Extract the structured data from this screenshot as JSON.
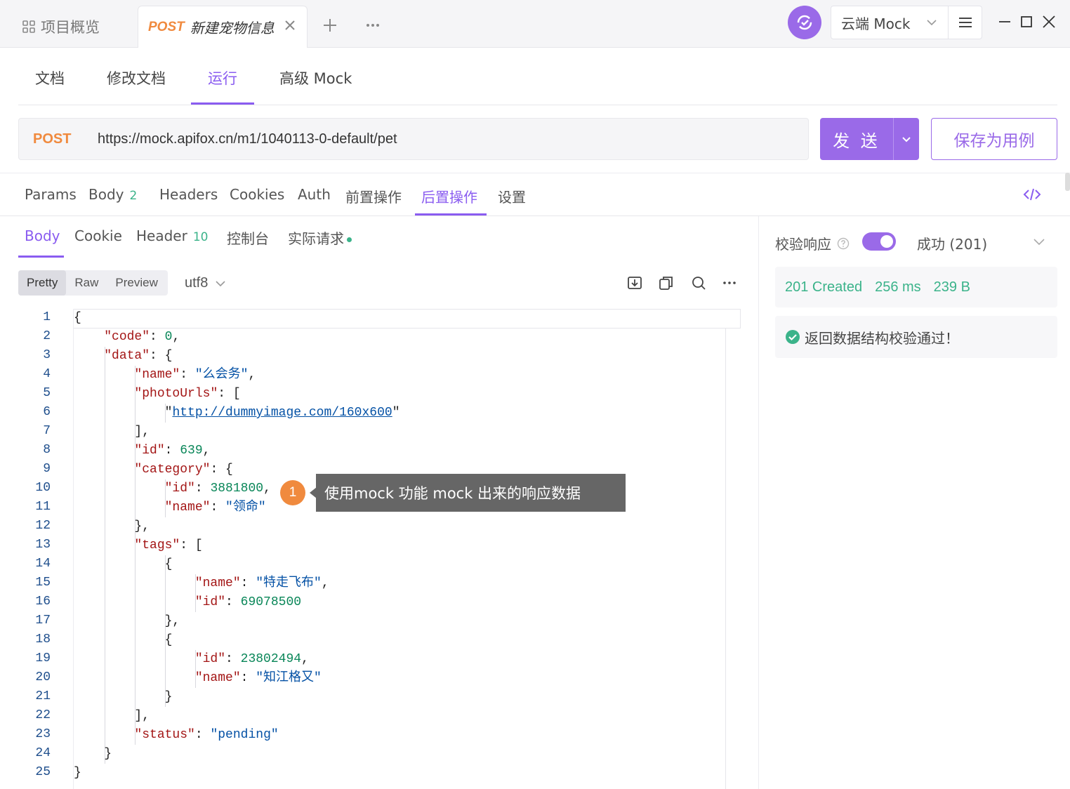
{
  "tabs": {
    "overview_label": "项目概览",
    "active_method": "POST",
    "active_title": "新建宠物信息"
  },
  "env": {
    "label": "云端 Mock"
  },
  "doc_tabs": [
    "文档",
    "修改文档",
    "运行",
    "高级 Mock"
  ],
  "request": {
    "method": "POST",
    "url": "https://mock.apifox.cn/m1/1040113-0-default/pet",
    "send_label": "发 送",
    "save_label": "保存为用例"
  },
  "req_tabs": {
    "params": "Params",
    "body": "Body",
    "body_count": "2",
    "headers": "Headers",
    "cookies": "Cookies",
    "auth": "Auth",
    "pre": "前置操作",
    "post": "后置操作",
    "settings": "设置"
  },
  "resp_tabs": {
    "body": "Body",
    "cookie": "Cookie",
    "header": "Header",
    "header_count": "10",
    "console": "控制台",
    "actual": "实际请求"
  },
  "view_modes": [
    "Pretty",
    "Raw",
    "Preview"
  ],
  "encoding": "utf8",
  "response_lines": [
    "{",
    "    \"code\": 0,",
    "    \"data\": {",
    "        \"name\": \"么会务\",",
    "        \"photoUrls\": [",
    "            \"http://dummyimage.com/160x600\"",
    "        ],",
    "        \"id\": 639,",
    "        \"category\": {",
    "            \"id\": 3881800,",
    "            \"name\": \"领命\"",
    "        },",
    "        \"tags\": [",
    "            {",
    "                \"name\": \"特走飞布\",",
    "                \"id\": 69078500",
    "            },",
    "            {",
    "                \"id\": 23802494,",
    "                \"name\": \"知江格又\"",
    "            }",
    "        ],",
    "        \"status\": \"pending\"",
    "    }",
    "}"
  ],
  "callout": {
    "number": "1",
    "text": "使用mock 功能 mock 出来的响应数据"
  },
  "validation": {
    "label": "校验响应",
    "enabled": true,
    "result": "成功 (201)",
    "status": "201 Created",
    "time": "256 ms",
    "size": "239 B",
    "message": "返回数据结构校验通过！"
  },
  "colors": {
    "accent": "#9a6ae8",
    "method": "#f08a3e",
    "success": "#3bb38a"
  }
}
